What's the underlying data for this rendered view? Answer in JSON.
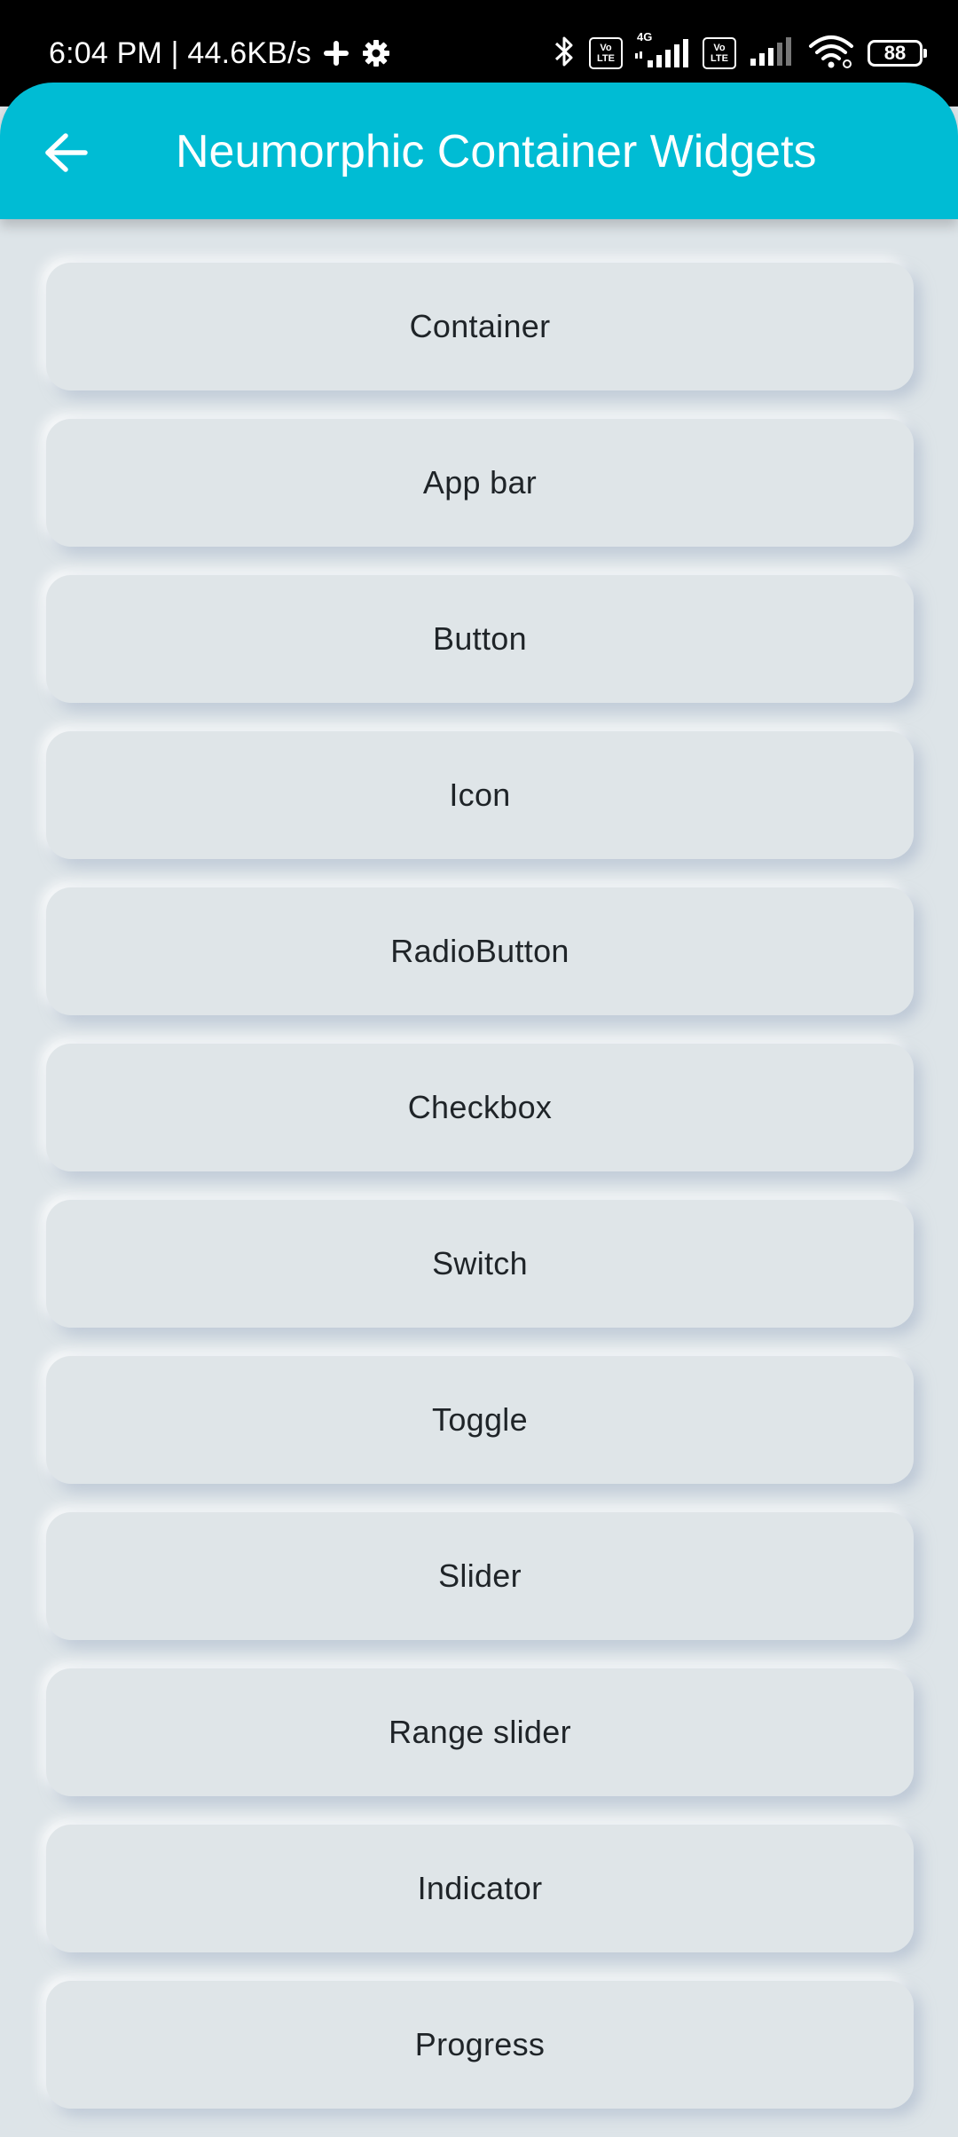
{
  "status_bar": {
    "time_speed": "6:04 PM | 44.6KB/s",
    "network_label": "4G",
    "volte_label_top": "Vo",
    "volte_label_bottom": "LTE",
    "battery": "88"
  },
  "app_bar": {
    "title": "Neumorphic Container Widgets",
    "color": "#00bcd4"
  },
  "list": {
    "items": [
      "Container",
      "App bar",
      "Button",
      "Icon",
      "RadioButton",
      "Checkbox",
      "Switch",
      "Toggle",
      "Slider",
      "Range slider",
      "Indicator",
      "Progress"
    ]
  }
}
